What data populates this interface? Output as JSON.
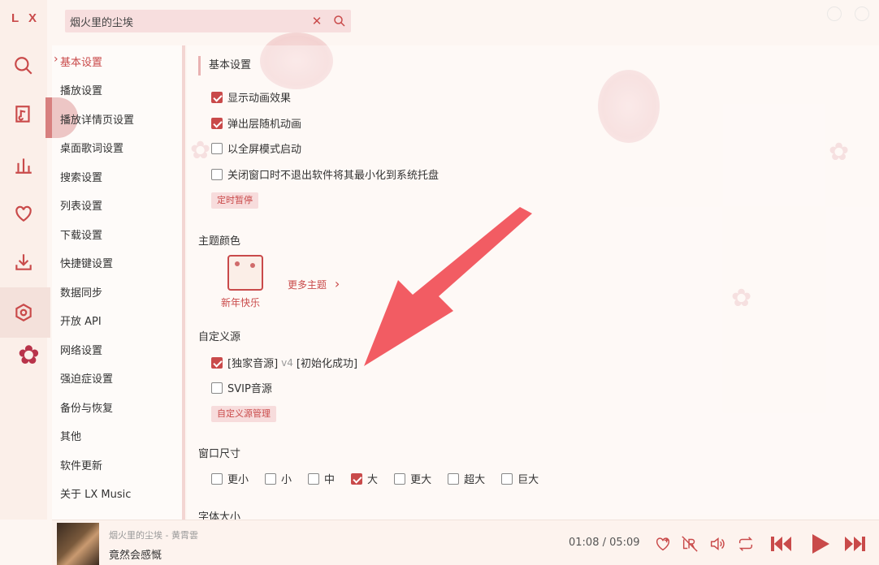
{
  "app": {
    "logo": "L X"
  },
  "search": {
    "value": "烟火里的尘埃"
  },
  "nav": {
    "items": [
      {
        "label": "基本设置",
        "active": true
      },
      {
        "label": "播放设置"
      },
      {
        "label": "播放详情页设置"
      },
      {
        "label": "桌面歌词设置"
      },
      {
        "label": "搜索设置"
      },
      {
        "label": "列表设置"
      },
      {
        "label": "下载设置"
      },
      {
        "label": "快捷键设置"
      },
      {
        "label": "数据同步"
      },
      {
        "label": "开放 API"
      },
      {
        "label": "网络设置"
      },
      {
        "label": "强迫症设置"
      },
      {
        "label": "备份与恢复"
      },
      {
        "label": "其他"
      },
      {
        "label": "软件更新"
      },
      {
        "label": "关于 LX Music"
      }
    ]
  },
  "basic": {
    "title": "基本设置",
    "options": [
      {
        "label": "显示动画效果",
        "checked": true
      },
      {
        "label": "弹出层随机动画",
        "checked": true
      },
      {
        "label": "以全屏模式启动",
        "checked": false
      },
      {
        "label": "关闭窗口时不退出软件将其最小化到系统托盘",
        "checked": false
      }
    ],
    "timer_button": "定时暂停"
  },
  "theme": {
    "title": "主题颜色",
    "current": "新年快乐",
    "more": "更多主题"
  },
  "custom_source": {
    "title": "自定义源",
    "sources": [
      {
        "name": "[独家音源]",
        "version": "v4",
        "status": "[初始化成功]",
        "checked": true
      },
      {
        "name": "SVIP音源",
        "version": "",
        "status": "",
        "checked": false
      }
    ],
    "manage_button": "自定义源管理"
  },
  "window_size": {
    "title": "窗口尺寸",
    "options": [
      {
        "label": "更小",
        "checked": false
      },
      {
        "label": "小",
        "checked": false
      },
      {
        "label": "中",
        "checked": false
      },
      {
        "label": "大",
        "checked": true
      },
      {
        "label": "更大",
        "checked": false
      },
      {
        "label": "超大",
        "checked": false
      },
      {
        "label": "巨大",
        "checked": false
      }
    ]
  },
  "font_size": {
    "title": "字体大小"
  },
  "player": {
    "song": "烟火里的尘埃 - 黄霄雲",
    "lyric": "竟然会感慨",
    "time": "01:08 / 05:09"
  },
  "colors": {
    "accent": "#c94a4a",
    "background": "#fdf6f2"
  },
  "icons": {
    "rail": [
      "search-icon",
      "music-note-icon",
      "chart-icon",
      "heart-icon",
      "download-icon",
      "settings-icon"
    ],
    "player": [
      "heart-icon",
      "lyric-icon",
      "volume-icon",
      "repeat-icon",
      "prev-icon",
      "play-icon",
      "next-icon"
    ]
  }
}
